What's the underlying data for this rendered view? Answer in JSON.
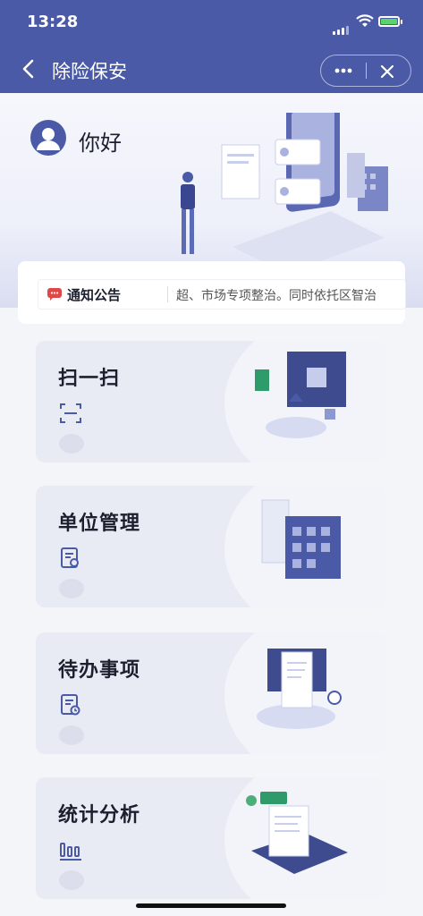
{
  "status_bar": {
    "time": "13:28"
  },
  "nav": {
    "title": "除险保安"
  },
  "hero": {
    "greeting": "你好"
  },
  "notice": {
    "label": "通知公告",
    "text": "超、市场专项整治。同时依托区智治"
  },
  "cards": [
    {
      "title": "扫一扫",
      "icon": "scan-icon"
    },
    {
      "title": "单位管理",
      "icon": "document-gear-icon"
    },
    {
      "title": "待办事项",
      "icon": "document-clock-icon"
    },
    {
      "title": "统计分析",
      "icon": "bar-chart-icon"
    }
  ],
  "colors": {
    "primary": "#4b5aa6",
    "card_bg": "#e9ebf4",
    "notice_icon": "#e04848"
  }
}
